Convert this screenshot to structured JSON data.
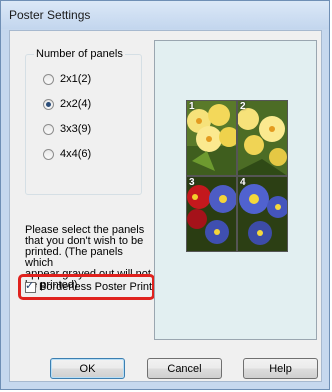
{
  "window": {
    "title": "Poster Settings"
  },
  "panels_group": {
    "legend": "Number of panels",
    "options": [
      {
        "label": "2x1(2)",
        "selected": false
      },
      {
        "label": "2x2(4)",
        "selected": true
      },
      {
        "label": "3x3(9)",
        "selected": false
      },
      {
        "label": "4x4(6)",
        "selected": false
      }
    ]
  },
  "instructions": "Please select the panels\nthat you don't wish to be\nprinted. (The panels which\nappear grayed out will not\nbe printed)",
  "borderless": {
    "label": "Borderless Poster Print",
    "checked": true
  },
  "preview": {
    "panel_numbers": [
      "1",
      "2",
      "3",
      "4"
    ]
  },
  "buttons": {
    "ok": "OK",
    "cancel": "Cancel",
    "help": "Help"
  },
  "colors": {
    "highlight": "#e0221e",
    "preview_bg": "#e2eff1",
    "title_bar": "#c3d6ee"
  }
}
